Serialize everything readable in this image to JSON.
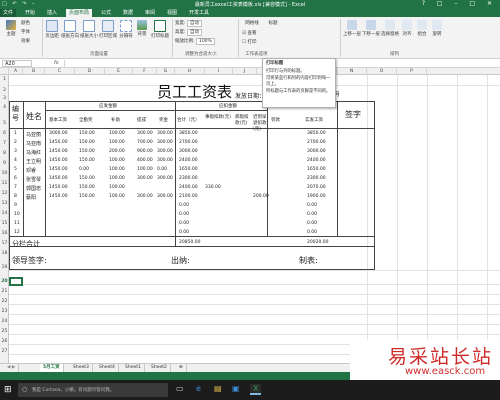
{
  "titlebar": {
    "title": "最新员工excel工资表模板.xls [兼容模式] - Excel",
    "quick_access": "□ ↶ ↷ –",
    "window_controls": "? □ – □ ✕"
  },
  "tabs": [
    "文件",
    "开始",
    "插入",
    "页面布局",
    "公式",
    "数据",
    "审阅",
    "视图",
    "开发工具"
  ],
  "active_tab": "页面布局",
  "ribbon": {
    "buttons": [
      "主题",
      "颜色",
      "字体",
      "效果",
      "页边距",
      "纸张方向",
      "纸张大小",
      "打印区域",
      "分隔符",
      "背景",
      "打印标题",
      "宽度",
      "高度",
      "缩放比例",
      "网格线",
      "标题",
      "查看",
      "打印",
      "上移一层",
      "下移一层",
      "选择窗格",
      "对齐",
      "组合",
      "旋转"
    ],
    "width_value": "自动",
    "height_value": "自动",
    "zoom_value": "100%",
    "groups": [
      "主题",
      "页面设置",
      "调整为合适大小",
      "工作表选项",
      "排列"
    ]
  },
  "formula_bar": {
    "cell_ref": "A20",
    "fx": "fx"
  },
  "columns": [
    "A",
    "B",
    "C",
    "D",
    "E",
    "F",
    "G",
    "H",
    "I",
    "J",
    "K",
    "L",
    "M",
    "N",
    "O",
    "P"
  ],
  "rows": [
    "1",
    "2",
    "3",
    "4",
    "5",
    "6",
    "7",
    "8",
    "9",
    "10",
    "11",
    "12",
    "13",
    "14",
    "15",
    "16",
    "17",
    "18",
    "19",
    "20",
    "21",
    "22",
    "23",
    "24",
    "25",
    "26",
    "27"
  ],
  "sheet": {
    "title": "员工工资表",
    "issue_date_label": "发放日期：",
    "issue_date_value": "2015年1月",
    "h_num": "编号",
    "h_name": "姓名",
    "h_payable": "应发金额",
    "h_deduct": "应扣金额",
    "h_sign": "签字",
    "sub_headers": [
      "基本工资",
      "全勤奖",
      "补助",
      "提成",
      "奖金",
      "合计（元）",
      "事假扣款(元)",
      "病假扣款(元)",
      "迟到早退扣款(元)",
      "罚款",
      "实发工资"
    ],
    "rows": [
      {
        "no": "1",
        "name": "马亚丽",
        "vals": [
          "3000.00",
          "150.00",
          "100.00",
          "300.00",
          "300.00",
          "3850.00",
          "",
          "",
          "",
          "",
          "3850.00"
        ]
      },
      {
        "no": "2",
        "name": "马亚南",
        "vals": [
          "1450.00",
          "150.00",
          "100.00",
          "700.00",
          "300.00",
          "2700.00",
          "",
          "",
          "",
          "",
          "2700.00"
        ]
      },
      {
        "no": "3",
        "name": "马海红",
        "vals": [
          "1450.00",
          "150.00",
          "200.00",
          "900.00",
          "300.00",
          "3000.00",
          "",
          "",
          "",
          "",
          "3000.00"
        ]
      },
      {
        "no": "4",
        "name": "王立明",
        "vals": [
          "1450.00",
          "150.00",
          "100.00",
          "400.00",
          "300.00",
          "2400.00",
          "",
          "",
          "",
          "",
          "2400.00"
        ]
      },
      {
        "no": "5",
        "name": "邓睿",
        "vals": [
          "1450.00",
          "0.00",
          "100.00",
          "100.00",
          "0.00",
          "1650.00",
          "",
          "",
          "",
          "",
          "1650.00"
        ]
      },
      {
        "no": "6",
        "name": "张雪琴",
        "vals": [
          "1450.00",
          "150.00",
          "100.00",
          "300.00",
          "300.00",
          "2300.00",
          "",
          "",
          "",
          "",
          "2300.00"
        ]
      },
      {
        "no": "7",
        "name": "郭国忠",
        "vals": [
          "1450.00",
          "150.00",
          "100.00",
          "",
          "",
          "2400.00",
          "330.00",
          "",
          "",
          "",
          "2070.00"
        ]
      },
      {
        "no": "8",
        "name": "蔡阳",
        "vals": [
          "1450.00",
          "150.00",
          "100.00",
          "300.00",
          "300.00",
          "2100.00",
          "",
          "",
          "200.00",
          "",
          "1900.00"
        ]
      },
      {
        "no": "9",
        "name": "",
        "vals": [
          "",
          "",
          "",
          "",
          "",
          "0.00",
          "",
          "",
          "",
          "",
          "0.00"
        ]
      },
      {
        "no": "10",
        "name": "",
        "vals": [
          "",
          "",
          "",
          "",
          "",
          "0.00",
          "",
          "",
          "",
          "",
          "0.00"
        ]
      },
      {
        "no": "11",
        "name": "",
        "vals": [
          "",
          "",
          "",
          "",
          "",
          "0.00",
          "",
          "",
          "",
          "",
          "0.00"
        ]
      },
      {
        "no": "12",
        "name": "",
        "vals": [
          "",
          "",
          "",
          "",
          "",
          "0.00",
          "",
          "",
          "",
          "",
          "0.00"
        ]
      }
    ],
    "subtotal_label": "分栏合计",
    "subtotal_total": "20850.00",
    "subtotal_net": "20020.00",
    "leader_sign": "领导签字:",
    "cashier": "出纳:",
    "preparer": "制表:"
  },
  "tooltip": {
    "title": "打印标题",
    "line1": "打印行与列的标题。",
    "line2": "可将某些行和列的内容打印到每一页上。",
    "line3": "所标题与工作表的页脚是不同的。"
  },
  "sheet_tabs": [
    "5月工资",
    "Sheet3",
    "Sheet4",
    "Sheet1",
    "Sheet2"
  ],
  "active_sheet": "5月工资",
  "taskbar": {
    "search": "我是 Cortana，小娜。有问题尽管问我。"
  },
  "watermark": {
    "brand": "易采站长站",
    "url": "www.easck.com"
  }
}
